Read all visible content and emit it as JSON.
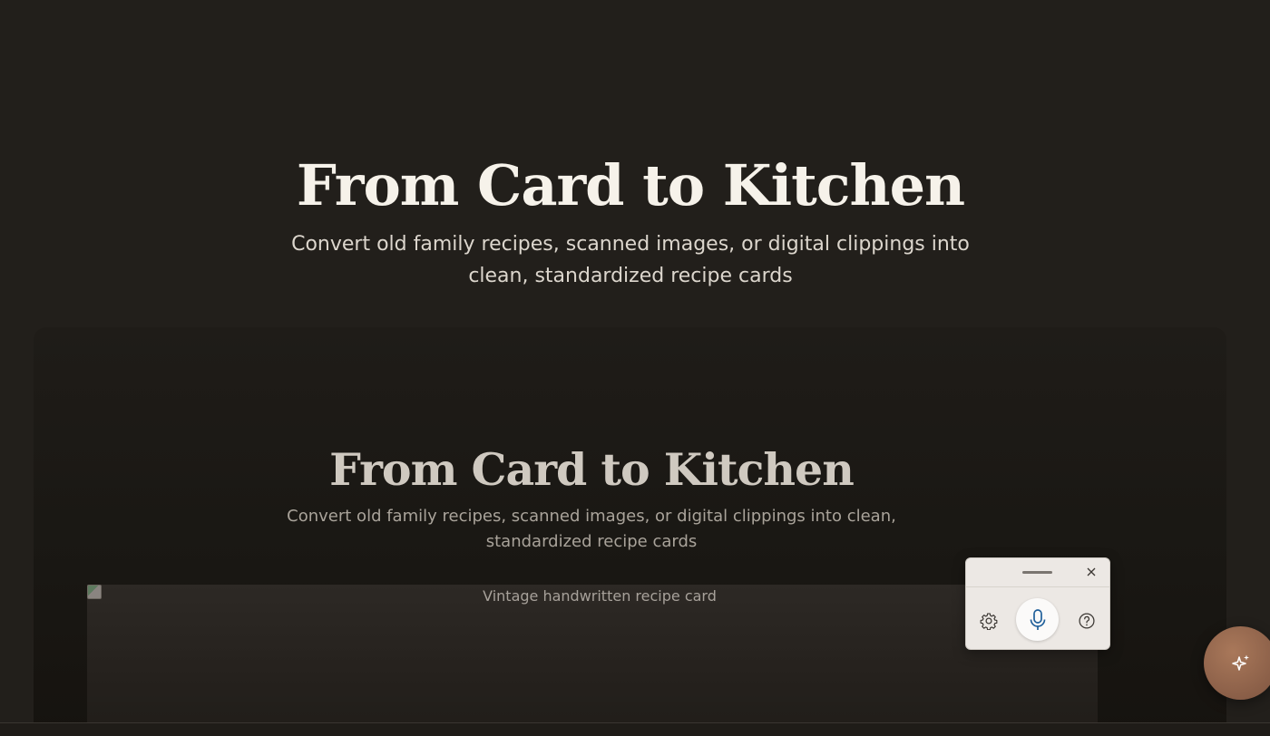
{
  "hero": {
    "title": "From Card to Kitchen",
    "subtitle": "Convert old family recipes, scanned images, or digital clippings into clean, standardized recipe cards"
  },
  "preview": {
    "title": "From Card to Kitchen",
    "subtitle": "Convert old family recipes, scanned images, or digital clippings into clean, standardized recipe cards",
    "image_alt": "Vintage handwritten recipe card"
  },
  "voice_widget": {
    "icons": [
      "close-icon",
      "gear-icon",
      "microphone-icon",
      "help-circle-icon"
    ],
    "mic_color": "#1f5f9a"
  },
  "fab": {
    "icon": "sparkle-icon",
    "color": "#8f6149"
  }
}
